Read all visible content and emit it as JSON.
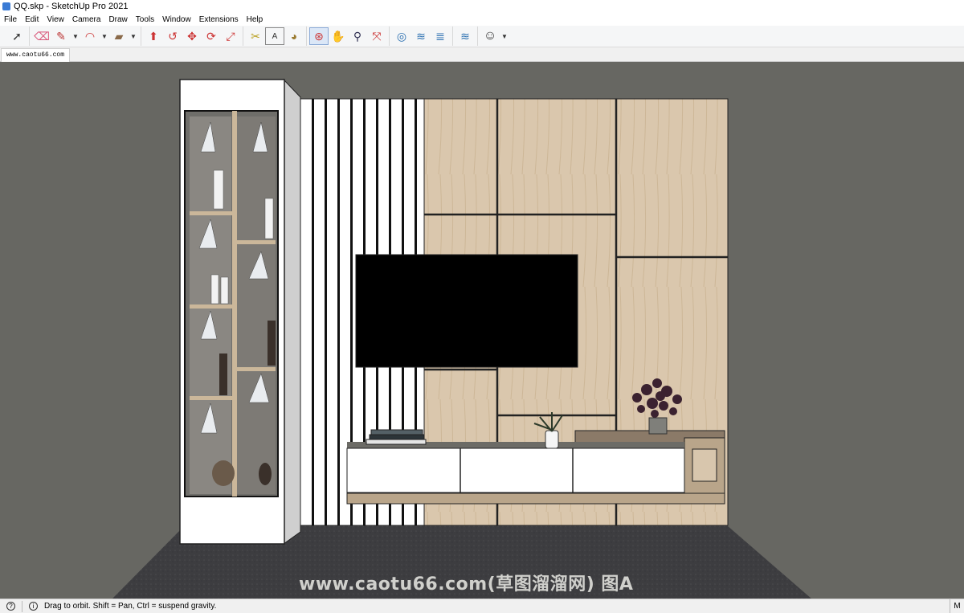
{
  "window": {
    "title": "QQ.skp - SketchUp Pro 2021"
  },
  "menu": [
    "File",
    "Edit",
    "View",
    "Camera",
    "Draw",
    "Tools",
    "Window",
    "Extensions",
    "Help"
  ],
  "toolbar": {
    "tools": [
      {
        "name": "select-tool",
        "glyph": "➚"
      },
      {
        "name": "eraser-tool",
        "glyph": "⌫"
      },
      {
        "name": "line-tool",
        "glyph": "✎"
      },
      {
        "name": "arc-tool",
        "glyph": "◠"
      },
      {
        "name": "rectangle-tool",
        "glyph": "▰"
      },
      {
        "name": "push-pull-tool",
        "glyph": "⬆"
      },
      {
        "name": "follow-me-tool",
        "glyph": "↺"
      },
      {
        "name": "move-tool",
        "glyph": "✥"
      },
      {
        "name": "rotate-tool",
        "glyph": "⟳"
      },
      {
        "name": "scale-tool",
        "glyph": "⤢"
      },
      {
        "name": "tape-measure-tool",
        "glyph": "✂"
      },
      {
        "name": "text-tool",
        "glyph": "A"
      },
      {
        "name": "paint-bucket-tool",
        "glyph": "◕"
      },
      {
        "name": "orbit-tool",
        "glyph": "⊛"
      },
      {
        "name": "pan-tool",
        "glyph": "✋"
      },
      {
        "name": "zoom-tool",
        "glyph": "⚲"
      },
      {
        "name": "zoom-extents-tool",
        "glyph": "⤧"
      },
      {
        "name": "warehouse-tool",
        "glyph": "◎"
      },
      {
        "name": "extension-warehouse-tool",
        "glyph": "≋"
      },
      {
        "name": "layout-tool",
        "glyph": "≣"
      },
      {
        "name": "extension-manager-tool",
        "glyph": "≋"
      },
      {
        "name": "account-tool",
        "glyph": "☺"
      }
    ]
  },
  "tab": {
    "label": "www.caotu66.com"
  },
  "viewport": {
    "watermark": "www.caotu66.com(草图溜溜网) 图A"
  },
  "statusbar": {
    "message": "Drag to orbit. Shift = Pan, Ctrl = suspend gravity.",
    "right": "M"
  },
  "colors": {
    "viewport_bg": "#676762",
    "wood": "#d9c6ab",
    "floor": "#3c3c3e",
    "tv": "#000000"
  }
}
